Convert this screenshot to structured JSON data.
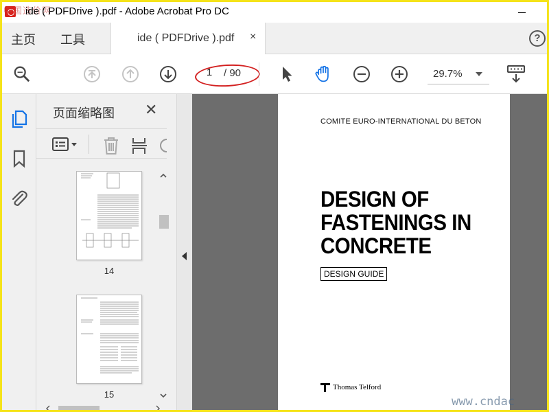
{
  "window": {
    "title": "ide ( PDFDrive ).pdf - Adobe Acrobat Pro DC"
  },
  "watermarks": {
    "top_left": "中国造价网",
    "bottom_right": "www.cndac"
  },
  "tabbar": {
    "home_label": "主页",
    "tools_label": "工具",
    "document_tab_label": "ide ( PDFDrive ).pdf",
    "close_glyph": "×",
    "help_glyph": "?"
  },
  "toolbar": {
    "current_page": "1",
    "total_pages": "/ 90",
    "zoom": "29.7%",
    "icons": [
      "search-zoom-icon",
      "first-page-icon",
      "previous-page-icon",
      "next-page-icon",
      "select-cursor-icon",
      "hand-tool-icon",
      "zoom-out-icon",
      "zoom-in-icon",
      "page-display-icon"
    ]
  },
  "annotation": {
    "red_circle_color": "#d32121"
  },
  "thumbnails_panel": {
    "title": "页面缩略图",
    "close_glyph": "✕",
    "thumbnails": [
      {
        "page_label": "14"
      },
      {
        "page_label": "15"
      }
    ]
  },
  "document": {
    "organization": "COMITE EURO-INTERNATIONAL DU BETON",
    "title_lines": [
      "DESIGN OF",
      "FASTENINGS IN",
      "CONCRETE"
    ],
    "subtitle_box": "DESIGN GUIDE",
    "publisher": "Thomas Telford"
  },
  "colors": {
    "frame_border": "#f5e31a",
    "hand_tool_active": "#1473e6",
    "sidebar_active_icon": "#1473e6",
    "viewport_bg": "#6d6d6d"
  }
}
